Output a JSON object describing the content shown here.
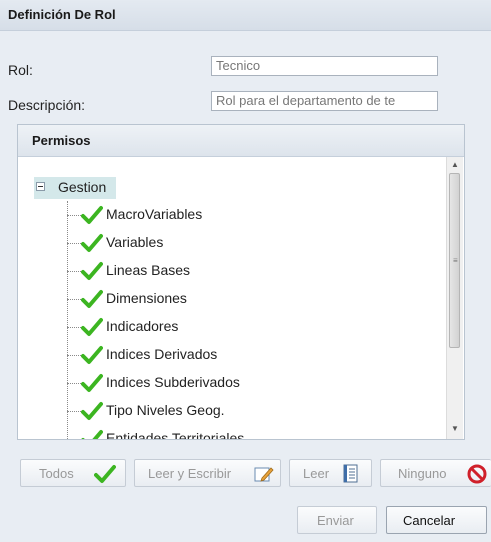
{
  "title": "Definición De Rol",
  "form": {
    "rol_label": "Rol:",
    "rol_value": "Tecnico",
    "descripcion_label": "Descripción:",
    "descripcion_value": "Rol para el departamento de te"
  },
  "permisos": {
    "header": "Permisos",
    "root": "Gestion",
    "items": [
      {
        "label": "MacroVariables",
        "checked": true
      },
      {
        "label": "Variables",
        "checked": true
      },
      {
        "label": "Lineas Bases",
        "checked": true
      },
      {
        "label": "Dimensiones",
        "checked": true
      },
      {
        "label": "Indicadores",
        "checked": true
      },
      {
        "label": "Indices Derivados",
        "checked": true
      },
      {
        "label": "Indices Subderivados",
        "checked": true
      },
      {
        "label": "Tipo Niveles Geog.",
        "checked": true
      },
      {
        "label": "Entidades Territoriales",
        "checked": true
      }
    ]
  },
  "buttons": {
    "todos": "Todos",
    "leer_escribir": "Leer y Escribir",
    "leer": "Leer",
    "ninguno": "Ninguno",
    "enviar": "Enviar",
    "cancelar": "Cancelar"
  },
  "colors": {
    "check": "#3cb521",
    "ninguno_icon": "#d0202a"
  }
}
